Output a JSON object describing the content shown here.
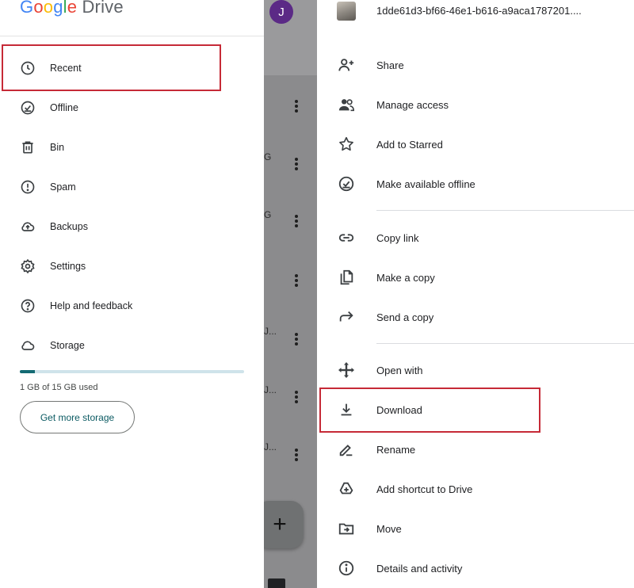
{
  "drawer": {
    "logo": {
      "google": "Google",
      "product": "Drive"
    },
    "items": [
      {
        "label": "Recent",
        "icon": "clock-icon"
      },
      {
        "label": "Offline",
        "icon": "offline-check-icon"
      },
      {
        "label": "Bin",
        "icon": "trash-icon"
      },
      {
        "label": "Spam",
        "icon": "spam-icon"
      },
      {
        "label": "Backups",
        "icon": "cloud-upload-icon"
      },
      {
        "label": "Settings",
        "icon": "gear-icon"
      },
      {
        "label": "Help and feedback",
        "icon": "help-icon"
      },
      {
        "label": "Storage",
        "icon": "cloud-icon"
      }
    ],
    "storage": {
      "used_text": "1 GB of 15 GB used",
      "used_fraction": 0.067
    },
    "get_storage_label": "Get more storage"
  },
  "background": {
    "avatar_initial": "J",
    "truncated": [
      "G",
      "G",
      "J...",
      "J...",
      "J..."
    ],
    "fab_symbol": "+"
  },
  "sheet": {
    "file_name": "1dde61d3-bf66-46e1-b616-a9aca1787201....",
    "groups": [
      [
        {
          "label": "Share",
          "icon": "person-add-icon"
        },
        {
          "label": "Manage access",
          "icon": "people-icon"
        },
        {
          "label": "Add to Starred",
          "icon": "star-icon"
        },
        {
          "label": "Make available offline",
          "icon": "offline-check-icon"
        }
      ],
      [
        {
          "label": "Copy link",
          "icon": "link-icon"
        },
        {
          "label": "Make a copy",
          "icon": "copy-icon"
        },
        {
          "label": "Send a copy",
          "icon": "send-arrow-icon"
        }
      ],
      [
        {
          "label": "Open with",
          "icon": "open-with-icon"
        },
        {
          "label": "Download",
          "icon": "download-icon"
        },
        {
          "label": "Rename",
          "icon": "rename-icon"
        },
        {
          "label": "Add shortcut to Drive",
          "icon": "add-shortcut-icon"
        },
        {
          "label": "Move",
          "icon": "move-folder-icon"
        },
        {
          "label": "Details and activity",
          "icon": "info-icon"
        }
      ]
    ]
  },
  "colors": {
    "highlight": "#c62a37",
    "accent": "#136a73",
    "scrim": "#8b8b8d"
  }
}
